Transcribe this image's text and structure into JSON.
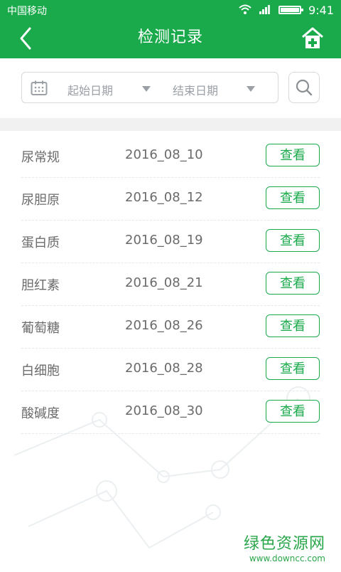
{
  "status": {
    "carrier": "中国移动",
    "time": "9:41"
  },
  "header": {
    "title": "检测记录",
    "back_icon": "back-chevron-icon",
    "home_icon": "home-plus-icon"
  },
  "filter": {
    "start_date_label": "起始日期",
    "end_date_label": "结束日期",
    "calendar_icon": "calendar-icon",
    "search_icon": "search-icon"
  },
  "records": [
    {
      "name": "尿常规",
      "date": "2016_08_10",
      "action": "查看"
    },
    {
      "name": "尿胆原",
      "date": "2016_08_12",
      "action": "查看"
    },
    {
      "name": "蛋白质",
      "date": "2016_08_19",
      "action": "查看"
    },
    {
      "name": "胆红素",
      "date": "2016_08_21",
      "action": "查看"
    },
    {
      "name": "葡萄糖",
      "date": "2016_08_26",
      "action": "查看"
    },
    {
      "name": "白细胞",
      "date": "2016_08_28",
      "action": "查看"
    },
    {
      "name": "酸碱度",
      "date": "2016_08_30",
      "action": "查看"
    }
  ],
  "watermark": {
    "main": "绿色资源网",
    "sub": "www.downcc.com"
  },
  "colors": {
    "accent": "#1aaa4b",
    "text": "#6b6b6b",
    "muted": "#9aa0a6"
  }
}
